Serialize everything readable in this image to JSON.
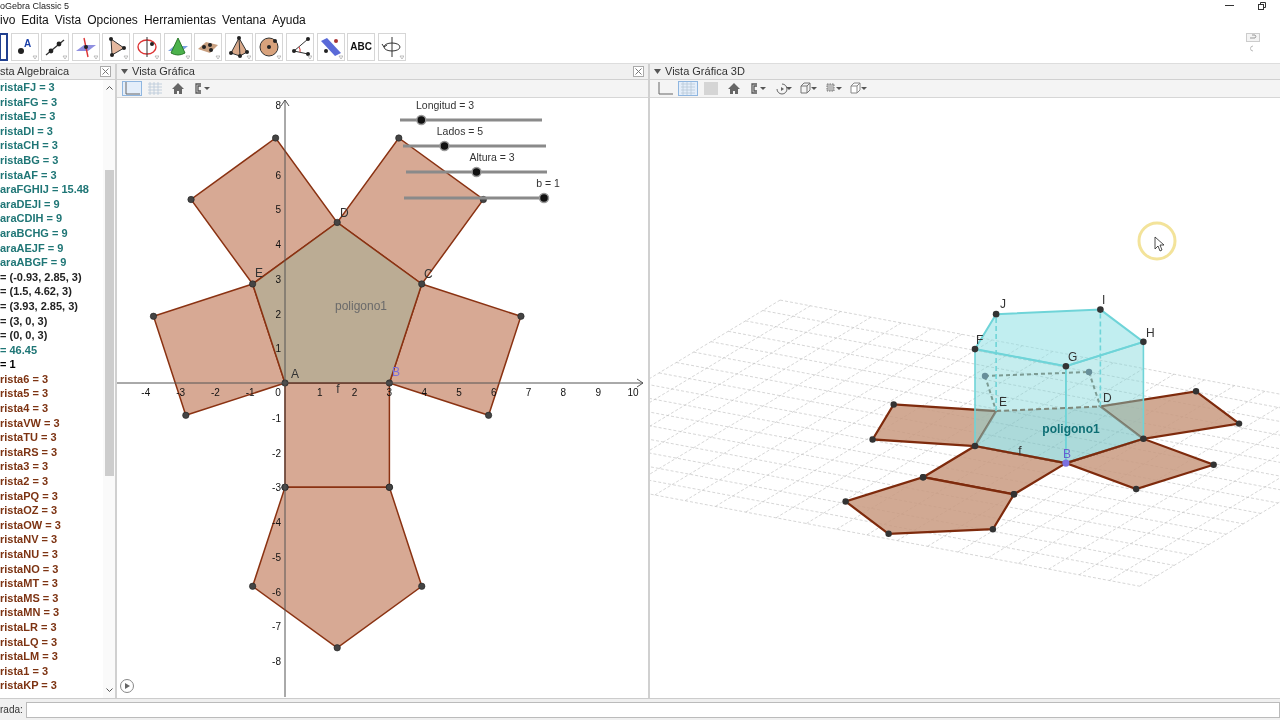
{
  "window": {
    "title": "oGebra Classic 5"
  },
  "menu": [
    "ivo",
    "Edita",
    "Vista",
    "Opciones",
    "Herramientas",
    "Ventana",
    "Ayuda"
  ],
  "tools": [
    {
      "kind": "move",
      "selected": true
    },
    {
      "kind": "point",
      "glyph": "A",
      "selected": false
    },
    {
      "kind": "line",
      "selected": false
    },
    {
      "kind": "perpendicular",
      "selected": false
    },
    {
      "kind": "polygon",
      "selected": false
    },
    {
      "kind": "circle",
      "selected": false
    },
    {
      "kind": "cone",
      "selected": false
    },
    {
      "kind": "plane",
      "selected": false
    },
    {
      "kind": "pyramid",
      "selected": false
    },
    {
      "kind": "sphere",
      "selected": false
    },
    {
      "kind": "angle",
      "selected": false
    },
    {
      "kind": "parallel",
      "selected": false
    },
    {
      "kind": "text",
      "glyph": "ABC",
      "selected": false
    },
    {
      "kind": "rotate",
      "selected": false
    }
  ],
  "algebra_view": {
    "title": "sta Algebraica",
    "items": [
      {
        "text": "ristaFJ = 3",
        "color": "#1f7676"
      },
      {
        "text": "ristaFG = 3",
        "color": "#1f7676"
      },
      {
        "text": "ristaEJ = 3",
        "color": "#1f7676"
      },
      {
        "text": "ristaDI = 3",
        "color": "#1f7676"
      },
      {
        "text": "ristaCH = 3",
        "color": "#1f7676"
      },
      {
        "text": "ristaBG = 3",
        "color": "#1f7676"
      },
      {
        "text": "ristaAF = 3",
        "color": "#1f7676"
      },
      {
        "text": "araFGHIJ = 15.48",
        "color": "#1f7676"
      },
      {
        "text": "araDEJI = 9",
        "color": "#1f7676"
      },
      {
        "text": "araCDIH = 9",
        "color": "#1f7676"
      },
      {
        "text": "araBCHG = 9",
        "color": "#1f7676"
      },
      {
        "text": "araAEJF = 9",
        "color": "#1f7676"
      },
      {
        "text": "araABGF = 9",
        "color": "#1f7676"
      },
      {
        "text": "= (-0.93, 2.85, 3)",
        "color": "#222222"
      },
      {
        "text": "= (1.5, 4.62, 3)",
        "color": "#222222"
      },
      {
        "text": "= (3.93, 2.85, 3)",
        "color": "#222222"
      },
      {
        "text": "= (3, 0, 3)",
        "color": "#222222"
      },
      {
        "text": "= (0, 0, 3)",
        "color": "#222222"
      },
      {
        "text": "= 46.45",
        "color": "#1f7676"
      },
      {
        "text": "= 1",
        "color": "#000000"
      },
      {
        "text": "rista6 = 3",
        "color": "#7d3312"
      },
      {
        "text": "rista5 = 3",
        "color": "#7d3312"
      },
      {
        "text": "rista4 = 3",
        "color": "#7d3312"
      },
      {
        "text": "ristaVW = 3",
        "color": "#7d3312"
      },
      {
        "text": "ristaTU = 3",
        "color": "#7d3312"
      },
      {
        "text": "ristaRS = 3",
        "color": "#7d3312"
      },
      {
        "text": "rista3 = 3",
        "color": "#7d3312"
      },
      {
        "text": "rista2 = 3",
        "color": "#7d3312"
      },
      {
        "text": "ristaPQ = 3",
        "color": "#7d3312"
      },
      {
        "text": "ristaOZ = 3",
        "color": "#7d3312"
      },
      {
        "text": "ristaOW = 3",
        "color": "#7d3312"
      },
      {
        "text": "ristaNV = 3",
        "color": "#7d3312"
      },
      {
        "text": "ristaNU = 3",
        "color": "#7d3312"
      },
      {
        "text": "ristaNO = 3",
        "color": "#7d3312"
      },
      {
        "text": "ristaMT = 3",
        "color": "#7d3312"
      },
      {
        "text": "ristaMS = 3",
        "color": "#7d3312"
      },
      {
        "text": "ristaMN = 3",
        "color": "#7d3312"
      },
      {
        "text": "ristaLR = 3",
        "color": "#7d3312"
      },
      {
        "text": "ristaLQ = 3",
        "color": "#7d3312"
      },
      {
        "text": "ristaLM = 3",
        "color": "#7d3312"
      },
      {
        "text": "rista1 = 3",
        "color": "#7d3312"
      },
      {
        "text": "ristaKP = 3",
        "color": "#7d3312"
      }
    ]
  },
  "graphics_view": {
    "title": "Vista Gráfica",
    "toolbar": [
      {
        "kind": "axes",
        "selected": true
      },
      {
        "kind": "grid",
        "selected": false
      },
      {
        "kind": "home",
        "selected": false
      },
      {
        "kind": "capture",
        "selected": false
      }
    ],
    "x_ticks": [
      "-4",
      "-3",
      "-2",
      "-1",
      "0",
      "1",
      "2",
      "3",
      "4",
      "5",
      "6",
      "7",
      "8",
      "9",
      "10"
    ],
    "y_ticks": [
      "8",
      "6",
      "5",
      "4",
      "3",
      "2",
      "1",
      "-1",
      "-2",
      "-3",
      "-4",
      "-5",
      "-6",
      "-7",
      "-8"
    ],
    "sliders": [
      {
        "label": "Longitud = 3",
        "level": 0.15
      },
      {
        "label": "Lados = 5",
        "level": 0.29
      },
      {
        "label": "Altura = 3",
        "level": 0.5
      },
      {
        "label": "b = 1",
        "level": 1
      }
    ],
    "labels": [
      {
        "text": "D",
        "highlighted": false
      },
      {
        "text": "E",
        "highlighted": false
      },
      {
        "text": "C",
        "highlighted": false
      },
      {
        "text": "poligono1",
        "highlighted": false
      },
      {
        "text": "A",
        "highlighted": false
      },
      {
        "text": "B",
        "highlighted": true
      },
      {
        "text": "f",
        "highlighted": false
      }
    ]
  },
  "graphics_3d_view": {
    "title": "Vista Gráfica 3D",
    "toolbar": [
      {
        "kind": "axes",
        "selected": false
      },
      {
        "kind": "grid",
        "selected": true
      },
      {
        "kind": "plane",
        "selected": false
      },
      {
        "kind": "home",
        "selected": false
      },
      {
        "kind": "capture",
        "selected": false
      },
      {
        "kind": "rotate",
        "selected": false
      },
      {
        "kind": "cube",
        "selected": false
      },
      {
        "kind": "frame",
        "selected": false
      },
      {
        "kind": "box",
        "selected": false
      }
    ],
    "labels": [
      {
        "text": "J",
        "highlighted": false
      },
      {
        "text": "I",
        "highlighted": false
      },
      {
        "text": "H",
        "highlighted": false
      },
      {
        "text": "F",
        "highlighted": false
      },
      {
        "text": "G",
        "highlighted": false
      },
      {
        "text": "E",
        "highlighted": false
      },
      {
        "text": "D",
        "highlighted": false
      },
      {
        "text": "poligono1",
        "highlighted": false
      },
      {
        "text": "f",
        "highlighted": false
      },
      {
        "text": "B",
        "highlighted": true
      }
    ]
  },
  "input_bar": {
    "label": "rada:"
  }
}
